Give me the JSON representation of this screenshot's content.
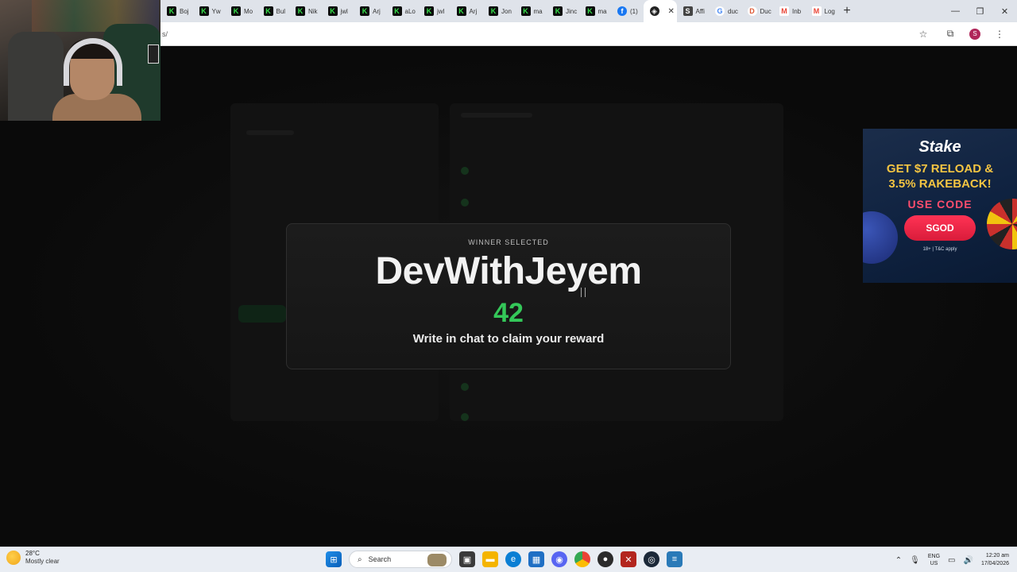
{
  "browser": {
    "tabs": [
      {
        "label": "Boj",
        "icon": "k"
      },
      {
        "label": "Yw",
        "icon": "k"
      },
      {
        "label": "Mo",
        "icon": "k"
      },
      {
        "label": "Bul",
        "icon": "k"
      },
      {
        "label": "Nik",
        "icon": "k"
      },
      {
        "label": "jwl",
        "icon": "k"
      },
      {
        "label": "Arj",
        "icon": "k"
      },
      {
        "label": "aLo",
        "icon": "k"
      },
      {
        "label": "jwl",
        "icon": "k"
      },
      {
        "label": "Arj",
        "icon": "k"
      },
      {
        "label": "Jon",
        "icon": "k"
      },
      {
        "label": "ma",
        "icon": "k"
      },
      {
        "label": "Jinc",
        "icon": "k"
      },
      {
        "label": "ma",
        "icon": "k"
      },
      {
        "label": "(1)",
        "icon": "fb"
      },
      {
        "label": "",
        "icon": "active"
      },
      {
        "label": "Affi",
        "icon": "s"
      },
      {
        "label": "duc",
        "icon": "g"
      },
      {
        "label": "Duc",
        "icon": "d"
      },
      {
        "label": "Inb",
        "icon": "m"
      },
      {
        "label": "Log",
        "icon": "m"
      }
    ],
    "url": "s/",
    "profile_initial": "S"
  },
  "modal": {
    "eyebrow": "WINNER SELECTED",
    "winner_name": "DevWithJeyem",
    "countdown": "42",
    "cta": "Write in chat to claim your reward"
  },
  "ad": {
    "brand": "Stake",
    "headline_1": "GET $7 RELOAD &",
    "headline_2": "3.5% RAKEBACK!",
    "use_code": "USE CODE",
    "code": "SGOD",
    "terms": "18+ | T&C apply"
  },
  "taskbar": {
    "temperature": "28°C",
    "condition": "Mostly clear",
    "search_placeholder": "Search",
    "lang_1": "ENG",
    "lang_2": "US",
    "time": "12:20 am",
    "date": "17/04/2026"
  },
  "colors": {
    "accent_green": "#34c759",
    "ad_yellow": "#f5c542",
    "ad_red": "#ff3355"
  }
}
